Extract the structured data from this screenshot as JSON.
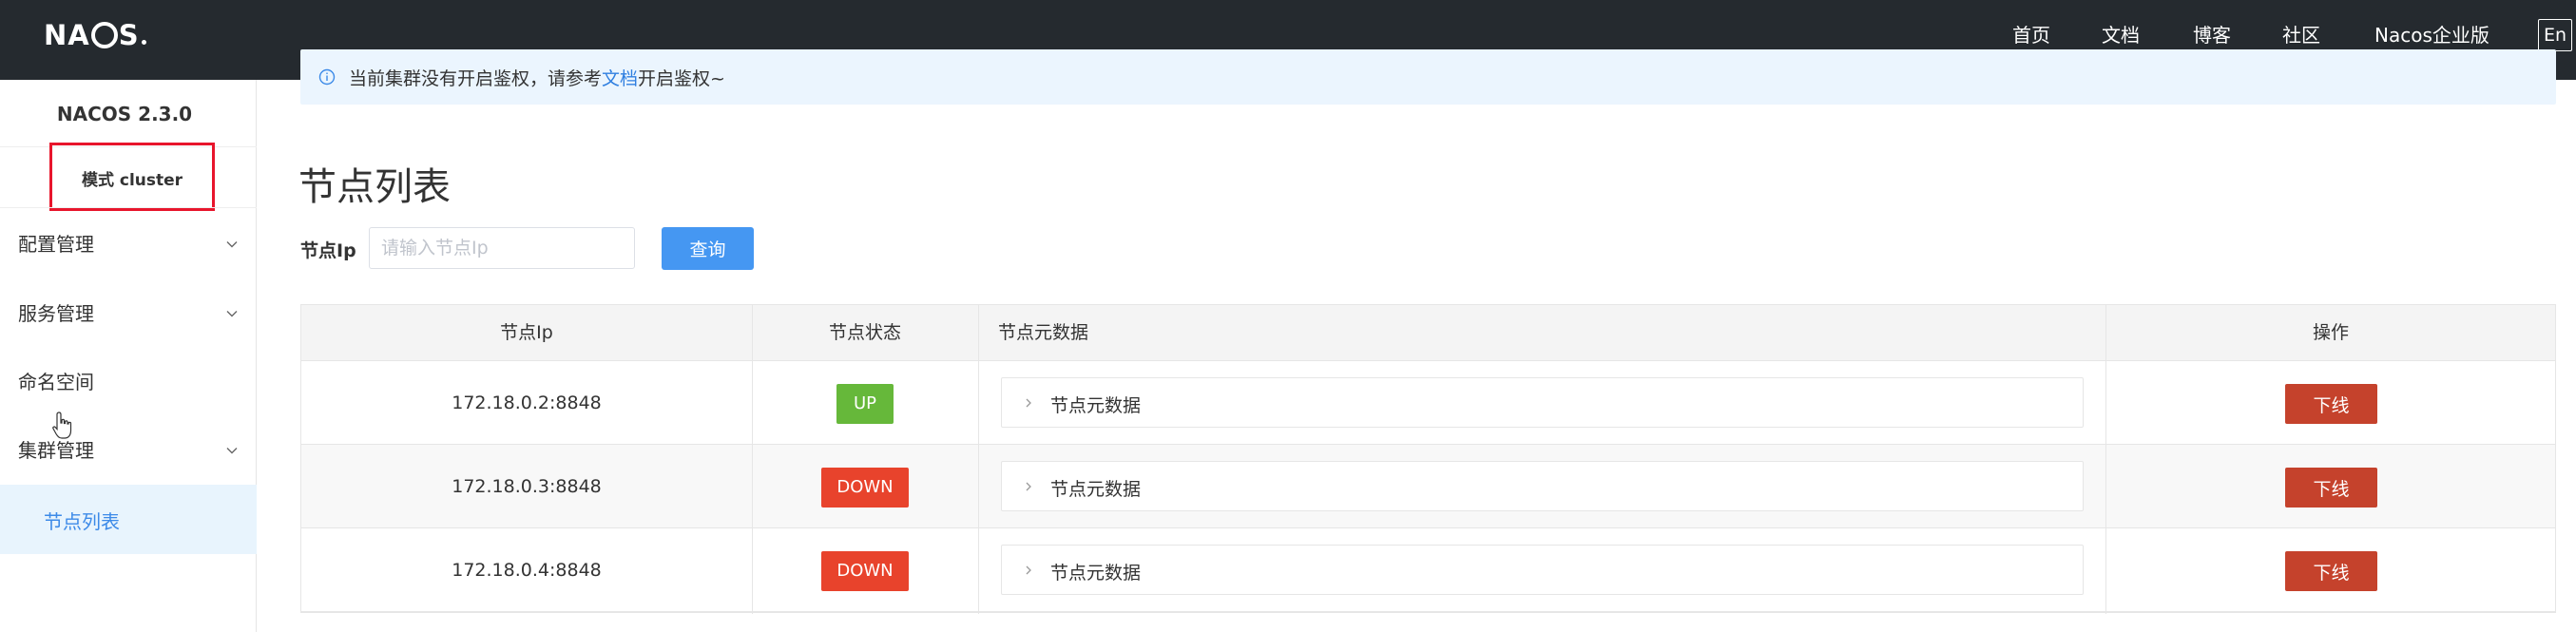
{
  "header": {
    "logo_text": "NACOS",
    "nav": [
      "首页",
      "文档",
      "博客",
      "社区",
      "Nacos企业版"
    ],
    "lang_button": "En"
  },
  "sidebar": {
    "version": "NACOS 2.3.0",
    "mode": "模式 cluster",
    "menu": [
      {
        "label": "配置管理",
        "expandable": true
      },
      {
        "label": "服务管理",
        "expandable": true
      },
      {
        "label": "命名空间",
        "expandable": false
      },
      {
        "label": "集群管理",
        "expandable": true
      }
    ],
    "active_item": "节点列表"
  },
  "notice": {
    "text_before": "当前集群没有开启鉴权，请参考",
    "link": "文档",
    "text_after": "开启鉴权~"
  },
  "page": {
    "title": "节点列表",
    "filter_label": "节点Ip",
    "filter_placeholder": "请输入节点Ip",
    "filter_value": "",
    "query_button": "查询"
  },
  "table": {
    "columns": [
      "节点Ip",
      "节点状态",
      "节点元数据",
      "操作"
    ],
    "rows": [
      {
        "ip": "172.18.0.2:8848",
        "status": "UP",
        "metadata_label": "节点元数据",
        "action": "下线"
      },
      {
        "ip": "172.18.0.3:8848",
        "status": "DOWN",
        "metadata_label": "节点元数据",
        "action": "下线"
      },
      {
        "ip": "172.18.0.4:8848",
        "status": "DOWN",
        "metadata_label": "节点元数据",
        "action": "下线"
      }
    ]
  },
  "colors": {
    "topbar": "#252a2f",
    "status_up": "#66b83a",
    "status_down": "#e8432c",
    "offline_button": "#c5422c",
    "query_button": "#4597f2",
    "active_menu_bg": "#e8f4fd",
    "highlight_box": "#e8152c"
  }
}
